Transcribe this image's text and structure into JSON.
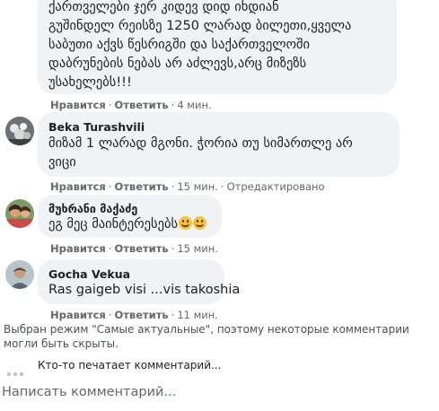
{
  "comments": [
    {
      "lines": [
        "ქართველები ჯერ კიდევ დიდ იხდიან",
        "გუშინდელ რეისზე 1250 ლარად ბილეთი,ყველა",
        "საბუთი აქვს წესრიგში და საქართველოში",
        "დაბრუნების ნებას არ აძლევს,არც მიზეზს",
        "უსახელებს!!!"
      ],
      "like": "Нравится",
      "reply": "Ответить",
      "time": "4 мин."
    },
    {
      "author": "Beka Turashvili",
      "lines": [
        "მიზამ 1 ლარად მგონი. ჭორია თუ სიმართლე არ",
        "ვიცი"
      ],
      "like": "Нравится",
      "reply": "Ответить",
      "time": "15 мин.",
      "edited": "Отредактировано"
    },
    {
      "author": "მუხრანი მაქაძე",
      "text": "ეგ მეც მაინტერესებს",
      "like": "Нравится",
      "reply": "Ответить",
      "time": "15 мин."
    },
    {
      "author": "Gocha Vekua",
      "text": "Ras gaigeb visi ...vis takoshia",
      "like": "Нравится",
      "reply": "Ответить",
      "time": "11 мин."
    }
  ],
  "notice": "Выбран режим \"Самые актуальные\", поэтому некоторые комментарии могли быть скрыты.",
  "typing": "Кто-то печатает комментарий...",
  "write_placeholder": "Написать комментарий...",
  "emoji_icon": "smiling-face-icon",
  "colors": {
    "bubble": "#f0f2f5",
    "meta": "#65676b",
    "text": "#1c1e21"
  }
}
